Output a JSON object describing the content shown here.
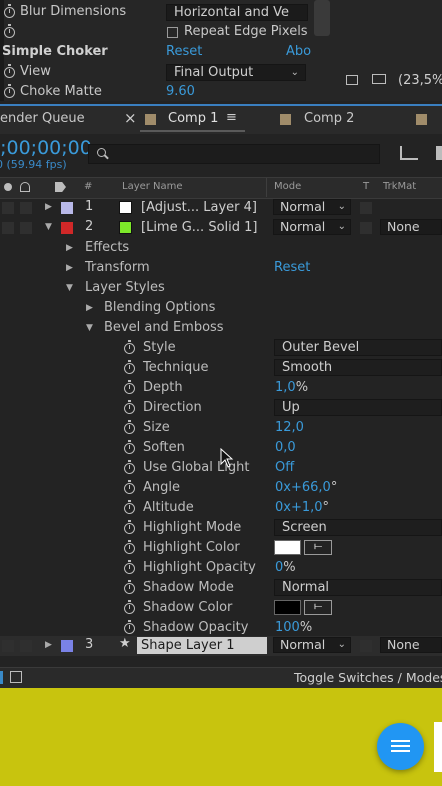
{
  "effect_controls": {
    "blur_dimensions_label": "Blur Dimensions",
    "blur_dimensions_value": "Horizontal and Ve",
    "repeat_edge_label": "Repeat Edge Pixels",
    "simple_choker_label": "Simple Choker",
    "reset_label": "Reset",
    "about_label": "Abo",
    "view_label": "View",
    "view_value": "Final Output",
    "choke_matte_label": "Choke Matte",
    "choke_matte_value": "9.60",
    "zoom_value": "(23,5%"
  },
  "tabs": {
    "render_queue": "ender Queue",
    "close_glyph": "×",
    "comp1": "Comp 1",
    "menu_glyph": "≡",
    "comp2": "Comp 2"
  },
  "comp_header": {
    "timecode": "0;00;00;00",
    "fps": "0 (59.94 fps)"
  },
  "columns": {
    "number": "#",
    "layer_name": "Layer Name",
    "mode": "Mode",
    "t": "T",
    "trkmat": "TrkMat"
  },
  "layers": [
    {
      "num": "1",
      "name": "[Adjust... Layer 4]",
      "mode": "Normal",
      "trkmat": "",
      "label_color": "#b8b8e8",
      "chip_color": "#ffffff"
    },
    {
      "num": "2",
      "name": "[Lime G... Solid 1]",
      "mode": "Normal",
      "trkmat": "None",
      "label_color": "#d02828",
      "chip_color": "#7de82a"
    },
    {
      "num": "3",
      "name": "Shape Layer 1",
      "mode": "Normal",
      "trkmat": "None",
      "label_color": "#7a82e6",
      "star": "★"
    }
  ],
  "groups": {
    "effects": "Effects",
    "transform": "Transform",
    "transform_reset": "Reset",
    "layer_styles": "Layer Styles",
    "blending_options": "Blending Options",
    "bevel_emboss": "Bevel and Emboss"
  },
  "properties": [
    {
      "name": "Style",
      "value": "Outer Bevel",
      "kind": "dropdown"
    },
    {
      "name": "Technique",
      "value": "Smooth",
      "kind": "dropdown"
    },
    {
      "name": "Depth",
      "value": "1,0",
      "suffix": "%",
      "kind": "number"
    },
    {
      "name": "Direction",
      "value": "Up",
      "kind": "dropdown"
    },
    {
      "name": "Size",
      "value": "12,0",
      "kind": "number"
    },
    {
      "name": "Soften",
      "value": "0,0",
      "kind": "number"
    },
    {
      "name": "Use Global Light",
      "value": "Off",
      "kind": "number"
    },
    {
      "name": "Angle",
      "value": "0x+66,0",
      "suffix": "°",
      "kind": "number"
    },
    {
      "name": "Altitude",
      "value": "0x+1,0",
      "suffix": "°",
      "kind": "number"
    },
    {
      "name": "Highlight Mode",
      "value": "Screen",
      "kind": "dropdown"
    },
    {
      "name": "Highlight Color",
      "value": "#ffffff",
      "kind": "color"
    },
    {
      "name": "Highlight Opacity",
      "value": "0",
      "suffix": "%",
      "kind": "number"
    },
    {
      "name": "Shadow Mode",
      "value": "Normal",
      "kind": "dropdown"
    },
    {
      "name": "Shadow Color",
      "value": "#000000",
      "kind": "color"
    },
    {
      "name": "Shadow Opacity",
      "value": "100",
      "suffix": "%",
      "kind": "number"
    }
  ],
  "bottom_bar": {
    "toggle_label": "Toggle Switches / Modes"
  },
  "accent_blue": "#3a9ad9",
  "fab_color": "#2196f3",
  "yellow_bg": "#c8c40e"
}
